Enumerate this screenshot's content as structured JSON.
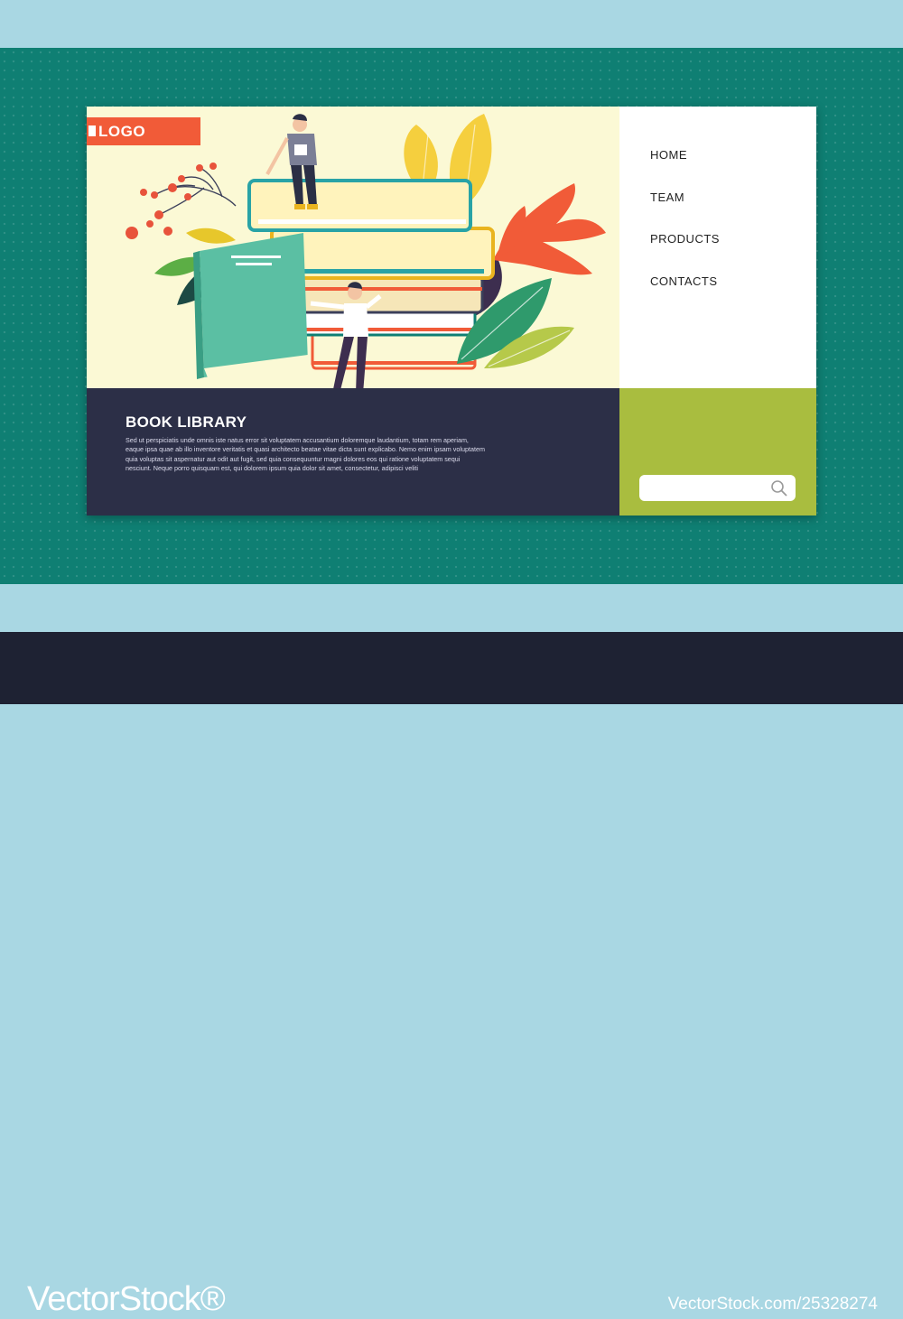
{
  "brand": {
    "logo_text": "LOGO"
  },
  "nav": {
    "items": [
      {
        "label": "HOME"
      },
      {
        "label": "TEAM"
      },
      {
        "label": "PRODUCTS"
      },
      {
        "label": "CONTACTS"
      }
    ]
  },
  "hero": {
    "title": "BOOK LIBRARY",
    "body": "Sed ut perspiciatis unde omnis iste natus error sit voluptatem accusantium doloremque laudantium, totam rem aperiam, eaque ipsa quae ab illo inventore veritatis et quasi architecto beatae vitae dicta sunt explicabo. Nemo enim ipsam voluptatem quia voluptas sit aspernatur aut odit aut fugit, sed quia consequuntur magni dolores eos qui ratione voluptatem sequi nesciunt. Neque porro quisquam est, qui dolorem ipsum quia dolor sit amet, consectetur, adipisci veliti"
  },
  "search": {
    "value": "",
    "placeholder": ""
  },
  "watermark": {
    "site": "VectorStock®",
    "image_id": "VectorStock.com/25328274"
  },
  "colors": {
    "page_bg": "#0f7f73",
    "band": "#a9d7e3",
    "hero_bg": "#fbf9d5",
    "footer_panel": "#2c2f47",
    "search_panel": "#a9bd3f",
    "logo_bg": "#f15b38"
  },
  "icons": {
    "search": "search-icon",
    "logo_mark": "logo-mark-icon"
  }
}
